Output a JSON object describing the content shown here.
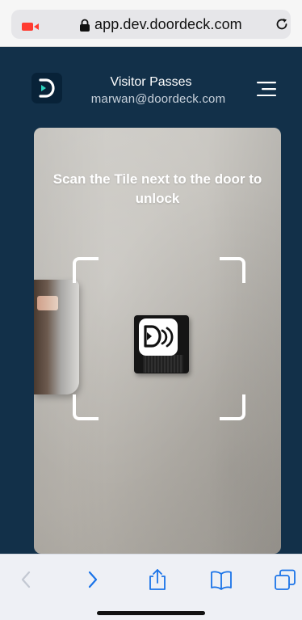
{
  "browser": {
    "url": "app.dev.doordeck.com",
    "icons": {
      "camera": "camera-recording-icon",
      "lock": "lock-icon",
      "reload": "reload-icon"
    },
    "toolbar": {
      "back": "chevron-left-icon",
      "forward": "chevron-right-icon",
      "share": "share-icon",
      "bookmarks": "book-icon",
      "tabs": "tabs-icon"
    }
  },
  "header": {
    "title": "Visitor Passes",
    "subtitle": "marwan@doordeck.com",
    "menu_icon": "menu-icon",
    "logo_icon": "doordeck-logo-icon"
  },
  "scanner": {
    "instruction": "Scan the Tile next to the door to unlock"
  },
  "colors": {
    "app_background": "#123049",
    "logo_background": "#082238",
    "accent_teal": "#2dd4bf",
    "recording_red": "#ff3b30",
    "toolbar_blue": "#1a73e8"
  }
}
